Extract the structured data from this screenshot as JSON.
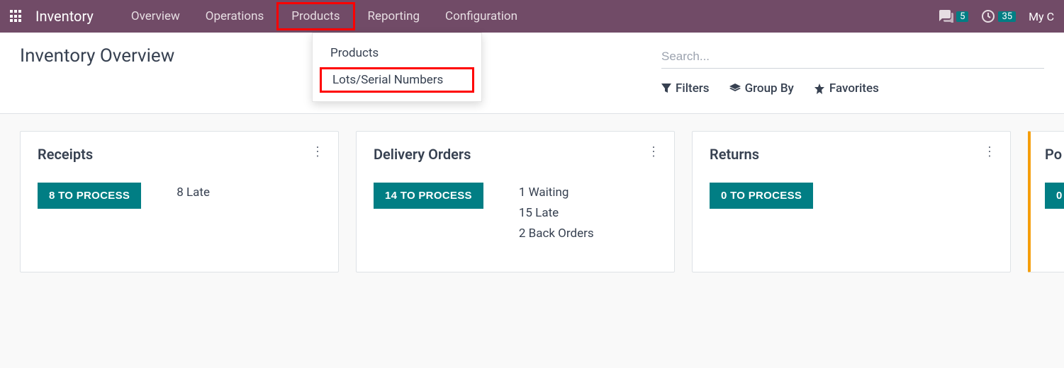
{
  "nav": {
    "app_title": "Inventory",
    "items": [
      "Overview",
      "Operations",
      "Products",
      "Reporting",
      "Configuration"
    ],
    "messages_badge": "5",
    "activities_badge": "35",
    "user_label": "My C"
  },
  "dropdown": {
    "items": [
      "Products",
      "Lots/Serial Numbers"
    ]
  },
  "page": {
    "title": "Inventory Overview",
    "search_placeholder": "Search...",
    "filters_label": "Filters",
    "groupby_label": "Group By",
    "favorites_label": "Favorites"
  },
  "cards": [
    {
      "title": "Receipts",
      "button": "8 TO PROCESS",
      "stats": [
        "8 Late"
      ]
    },
    {
      "title": "Delivery Orders",
      "button": "14 TO PROCESS",
      "stats": [
        "1 Waiting",
        "15 Late",
        "2 Back Orders"
      ]
    },
    {
      "title": "Returns",
      "button": "0 TO PROCESS",
      "stats": []
    },
    {
      "title": "Po",
      "button": "0",
      "stats": []
    }
  ]
}
